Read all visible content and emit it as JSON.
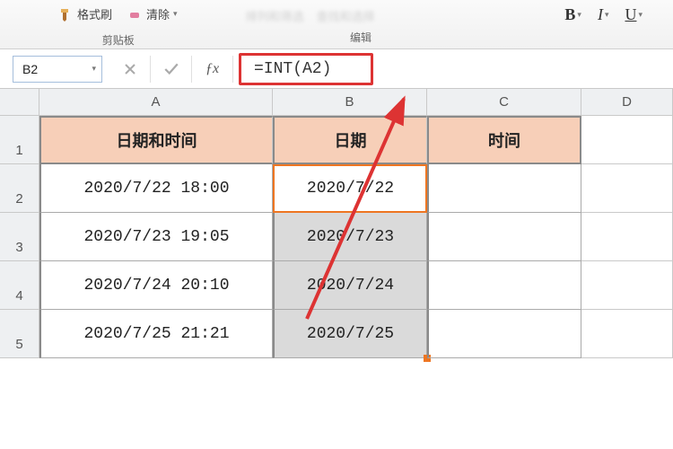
{
  "ribbon": {
    "format_painter_label": "格式刷",
    "clear_label": "清除",
    "clipboard_group": "剪贴板",
    "edit_group": "编辑",
    "hidden1": "排列和筛选",
    "hidden2": "查找和选择",
    "font_b": "B",
    "font_i": "I",
    "font_u": "U"
  },
  "namebox": "B2",
  "formula": "=INT(A2)",
  "col_labels": [
    "A",
    "B",
    "C",
    "D"
  ],
  "row_labels": [
    "1",
    "2",
    "3",
    "4",
    "5"
  ],
  "table": {
    "headers": [
      "日期和时间",
      "日期",
      "时间"
    ],
    "rows": [
      {
        "a": "2020/7/22 18:00",
        "b": "2020/7/22",
        "c": ""
      },
      {
        "a": "2020/7/23 19:05",
        "b": "2020/7/23",
        "c": ""
      },
      {
        "a": "2020/7/24 20:10",
        "b": "2020/7/24",
        "c": ""
      },
      {
        "a": "2020/7/25 21:21",
        "b": "2020/7/25",
        "c": ""
      }
    ]
  },
  "annot_color": "#d33"
}
